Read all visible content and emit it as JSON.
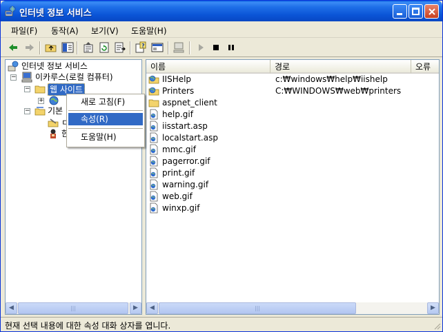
{
  "window": {
    "title": "인터넷 정보 서비스"
  },
  "menu": [
    {
      "label": "파일(F)"
    },
    {
      "label": "동작(A)"
    },
    {
      "label": "보기(V)"
    },
    {
      "label": "도움말(H)"
    }
  ],
  "toolbar": {
    "buttons": [
      "back-icon",
      "forward-icon",
      "up-folder-icon",
      "show-tree-icon",
      "properties-icon",
      "refresh-icon",
      "export-list-icon",
      "help-icon",
      "show-console-icon",
      "computer-icon",
      "start-icon",
      "stop-icon",
      "pause-icon"
    ]
  },
  "tree": {
    "root": "인터넷 정보 서비스",
    "computer": "이카루스(로컬 컴퓨터)",
    "websites": "웹 사이트",
    "default_site_partial": "",
    "child_partial_2": "기본",
    "child_partial_3": "ㄷ",
    "child_partial_4": "한"
  },
  "context_menu": {
    "items": [
      "새로 고침(F)",
      "속성(R)",
      "도움말(H)"
    ],
    "selected_index": 1
  },
  "list": {
    "columns": [
      "이름",
      "경로",
      "오류"
    ],
    "rows": [
      {
        "name": "IISHelp",
        "path": "c:₩windows₩help₩iishelp",
        "icon": "virtual-dir-icon"
      },
      {
        "name": "Printers",
        "path": "C:₩WINDOWS₩web₩printers",
        "icon": "virtual-dir-icon"
      },
      {
        "name": "aspnet_client",
        "path": "",
        "icon": "folder-icon"
      },
      {
        "name": "help.gif",
        "path": "",
        "icon": "file-icon"
      },
      {
        "name": "iisstart.asp",
        "path": "",
        "icon": "file-icon"
      },
      {
        "name": "localstart.asp",
        "path": "",
        "icon": "file-icon"
      },
      {
        "name": "mmc.gif",
        "path": "",
        "icon": "file-icon"
      },
      {
        "name": "pagerror.gif",
        "path": "",
        "icon": "file-icon"
      },
      {
        "name": "print.gif",
        "path": "",
        "icon": "file-icon"
      },
      {
        "name": "warning.gif",
        "path": "",
        "icon": "file-icon"
      },
      {
        "name": "web.gif",
        "path": "",
        "icon": "file-icon"
      },
      {
        "name": "winxp.gif",
        "path": "",
        "icon": "file-icon"
      }
    ]
  },
  "status": {
    "text": "현재 선택 내용에 대한 속성 대화 상자를 엽니다."
  },
  "colors": {
    "selection": "#316ac5",
    "titlebar": "#0a54d6"
  }
}
